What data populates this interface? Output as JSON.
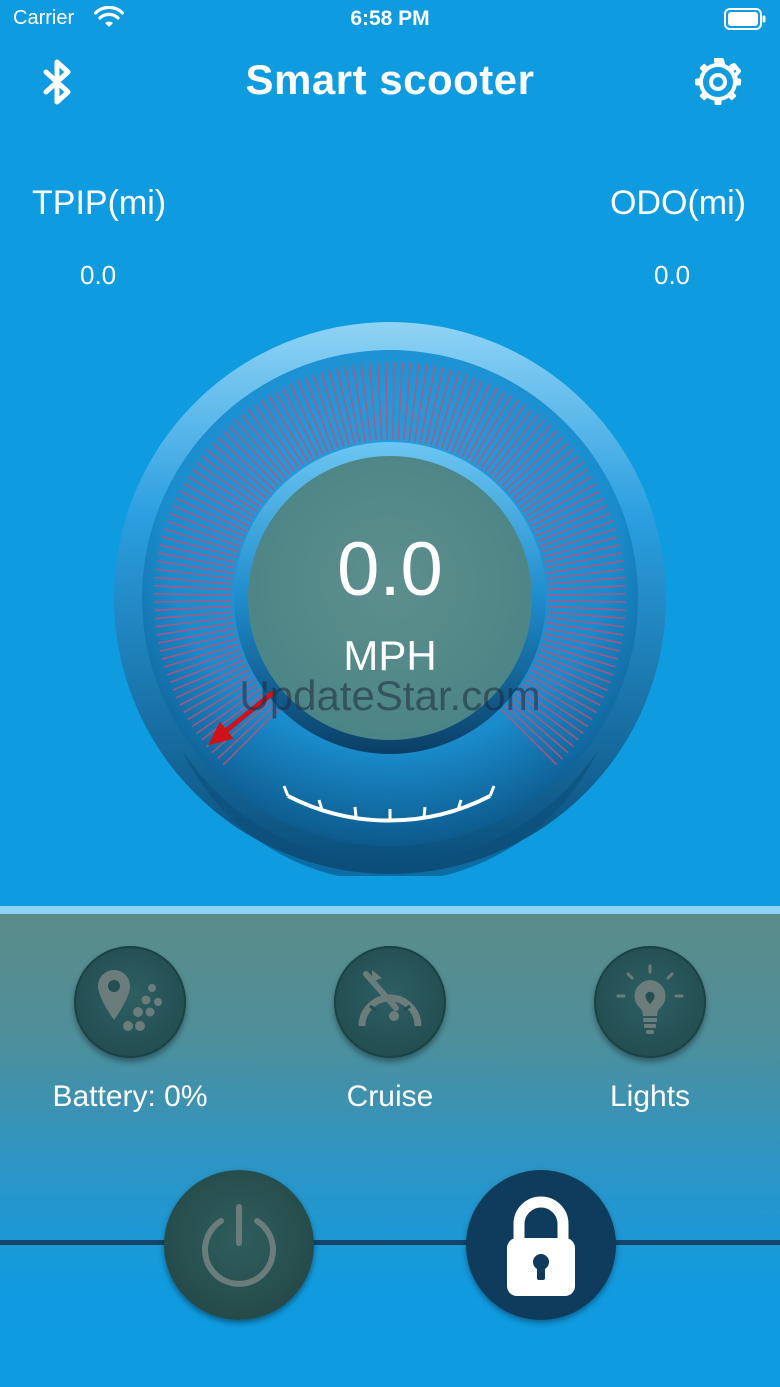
{
  "status_bar": {
    "carrier": "Carrier",
    "time": "6:58 PM"
  },
  "header": {
    "title": "Smart scooter",
    "left_icon": "bluetooth-icon",
    "right_icon": "gear-icon"
  },
  "stats": {
    "trip_label": "TPIP(mi)",
    "trip_value": "0.0",
    "odo_label": "ODO(mi)",
    "odo_value": "0.0"
  },
  "speedometer": {
    "speed": "0.0",
    "unit": "MPH",
    "watermark": "UpdateStar.com",
    "needle_fraction": 0
  },
  "features": [
    {
      "label": "Battery: 0%",
      "icon": "location-dots-icon"
    },
    {
      "label": "Cruise",
      "icon": "cruise-gauge-icon"
    },
    {
      "label": "Lights",
      "icon": "light-bulb-icon"
    }
  ],
  "controls": {
    "power_icon": "power-icon",
    "lock_icon": "lock-icon"
  },
  "colors": {
    "background": "#0e9be0",
    "needle": "#d0111a",
    "lock_button": "#0f3b5c",
    "tick_marks": "#c0507a"
  }
}
